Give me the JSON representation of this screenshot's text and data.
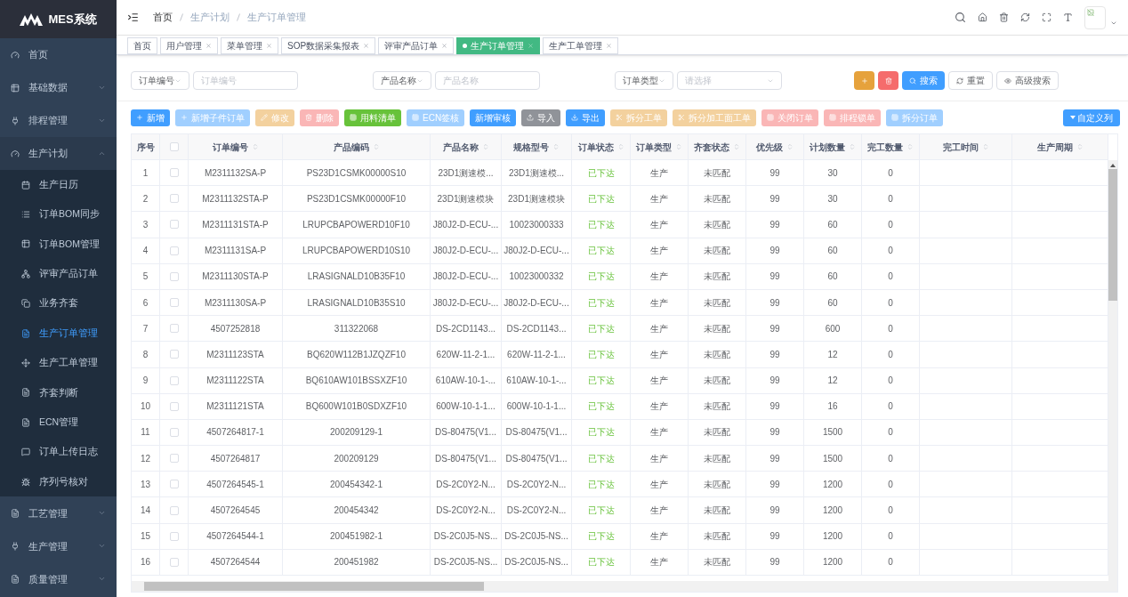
{
  "brand": {
    "title": "MES系统"
  },
  "sidebar": {
    "items": [
      {
        "label": "首页"
      },
      {
        "label": "基础数据",
        "expanded": false
      },
      {
        "label": "排程管理",
        "expanded": false
      },
      {
        "label": "生产计划",
        "expanded": true,
        "children": [
          {
            "label": "生产日历",
            "selected": false
          },
          {
            "label": "订单BOM同步",
            "selected": false
          },
          {
            "label": "订单BOM管理",
            "selected": false
          },
          {
            "label": "评审产品订单",
            "selected": false
          },
          {
            "label": "业务齐套",
            "selected": false
          },
          {
            "label": "生产订单管理",
            "selected": true
          },
          {
            "label": "生产工单管理",
            "selected": false
          },
          {
            "label": "齐套判断",
            "selected": false
          },
          {
            "label": "ECN管理",
            "selected": false
          },
          {
            "label": "订单上传日志",
            "selected": false
          },
          {
            "label": "序列号核对",
            "selected": false
          }
        ]
      },
      {
        "label": "工艺管理",
        "expanded": false
      },
      {
        "label": "生产管理",
        "expanded": false
      },
      {
        "label": "质量管理",
        "expanded": false
      }
    ]
  },
  "breadcrumb": [
    "首页",
    "生产计划",
    "生产订单管理"
  ],
  "tags": [
    {
      "label": "首页",
      "selected": false,
      "closable": false
    },
    {
      "label": "用户管理",
      "selected": false,
      "closable": true
    },
    {
      "label": "菜单管理",
      "selected": false,
      "closable": true
    },
    {
      "label": "SOP数据采集报表",
      "selected": false,
      "closable": true
    },
    {
      "label": "评审产品订单",
      "selected": false,
      "closable": true
    },
    {
      "label": "生产订单管理",
      "selected": true,
      "closable": true
    },
    {
      "label": "生产工单管理",
      "selected": false,
      "closable": true
    }
  ],
  "filters": [
    {
      "field": "订单编号",
      "placeholder": "订单编号",
      "kind": "input"
    },
    {
      "field": "产品名称",
      "placeholder": "产品名称",
      "kind": "input"
    },
    {
      "field": "订单类型",
      "placeholder": "请选择",
      "kind": "select"
    }
  ],
  "search_buttons": [
    {
      "kind": "add"
    },
    {
      "kind": "delete"
    },
    {
      "kind": "search",
      "label": "搜索"
    },
    {
      "kind": "reset",
      "label": "重置"
    },
    {
      "kind": "advanced",
      "label": "高级搜索"
    }
  ],
  "actions": [
    {
      "label": "新增",
      "kind": "primary",
      "disabled": false
    },
    {
      "label": "新增子件订单",
      "kind": "primary",
      "disabled": true
    },
    {
      "label": "修改",
      "kind": "warning",
      "disabled": true
    },
    {
      "label": "删除",
      "kind": "danger",
      "disabled": true
    },
    {
      "label": "用料清单",
      "kind": "success",
      "disabled": false
    },
    {
      "label": "ECN签核",
      "kind": "primary",
      "disabled": true
    },
    {
      "label": "新增审核",
      "kind": "primary",
      "disabled": false
    },
    {
      "label": "导入",
      "kind": "info",
      "disabled": false
    },
    {
      "label": "导出",
      "kind": "primary",
      "disabled": false
    },
    {
      "label": "拆分工单",
      "kind": "warning",
      "disabled": true
    },
    {
      "label": "拆分加工面工单",
      "kind": "warning",
      "disabled": true
    },
    {
      "label": "关闭订单",
      "kind": "danger",
      "disabled": true
    },
    {
      "label": "排程锁单",
      "kind": "danger",
      "disabled": true
    },
    {
      "label": "拆分订单",
      "kind": "primary",
      "disabled": true
    }
  ],
  "custom_columns": {
    "label": "自定义列"
  },
  "table": {
    "header_checked": false,
    "columns": [
      {
        "label": "序号",
        "kind": "index",
        "sortable": false
      },
      {
        "kind": "check"
      },
      {
        "label": "订单编号",
        "kind": "text",
        "sortable": true
      },
      {
        "label": "产品编码",
        "kind": "text",
        "sortable": true
      },
      {
        "label": "产品名称",
        "kind": "text",
        "sortable": true
      },
      {
        "label": "规格型号",
        "kind": "text",
        "sortable": true
      },
      {
        "label": "订单状态",
        "kind": "status",
        "sortable": true
      },
      {
        "label": "订单类型",
        "kind": "text",
        "sortable": true
      },
      {
        "label": "齐套状态",
        "kind": "text",
        "sortable": true
      },
      {
        "label": "优先级",
        "kind": "text",
        "sortable": true
      },
      {
        "label": "计划数量",
        "kind": "text",
        "sortable": true
      },
      {
        "label": "完工数量",
        "kind": "text",
        "sortable": true
      },
      {
        "label": "完工时间",
        "kind": "text",
        "sortable": true
      },
      {
        "label": "生产周期",
        "kind": "text",
        "sortable": true
      }
    ],
    "rows": [
      {
        "checked": false,
        "cells": [
          "1",
          null,
          "M2311132SA-P",
          "PS23D1CSMK00000S10",
          "23D1测速模...",
          "23D1测速模...",
          "已下达",
          "生产",
          "未匹配",
          "99",
          "30",
          "0",
          null,
          null
        ]
      },
      {
        "checked": false,
        "cells": [
          "2",
          null,
          "M2311132STA-P",
          "PS23D1CSMK00000F10",
          "23D1测速模块",
          "23D1测速模块",
          "已下达",
          "生产",
          "未匹配",
          "99",
          "30",
          "0",
          null,
          null
        ]
      },
      {
        "checked": false,
        "cells": [
          "3",
          null,
          "M2311131STA-P",
          "LRUPCBAPOWERD10F10",
          "J80J2-D-ECU-...",
          "10023000333",
          "已下达",
          "生产",
          "未匹配",
          "99",
          "60",
          "0",
          null,
          null
        ]
      },
      {
        "checked": false,
        "cells": [
          "4",
          null,
          "M2311131SA-P",
          "LRUPCBAPOWERD10S10",
          "J80J2-D-ECU-...",
          "J80J2-D-ECU-...",
          "已下达",
          "生产",
          "未匹配",
          "99",
          "60",
          "0",
          null,
          null
        ]
      },
      {
        "checked": false,
        "cells": [
          "5",
          null,
          "M2311130STA-P",
          "LRASIGNALD10B35F10",
          "J80J2-D-ECU-...",
          "10023000332",
          "已下达",
          "生产",
          "未匹配",
          "99",
          "60",
          "0",
          null,
          null
        ]
      },
      {
        "checked": false,
        "cells": [
          "6",
          null,
          "M2311130SA-P",
          "LRASIGNALD10B35S10",
          "J80J2-D-ECU-...",
          "J80J2-D-ECU-...",
          "已下达",
          "生产",
          "未匹配",
          "99",
          "60",
          "0",
          null,
          null
        ]
      },
      {
        "checked": false,
        "cells": [
          "7",
          null,
          "4507252818",
          "311322068",
          "DS-2CD1143...",
          "DS-2CD1143...",
          "已下达",
          "生产",
          "未匹配",
          "99",
          "600",
          "0",
          null,
          null
        ]
      },
      {
        "checked": false,
        "cells": [
          "8",
          null,
          "M2311123STA",
          "BQ620W112B1JZQZF10",
          "620W-11-2-1...",
          "620W-11-2-1...",
          "已下达",
          "生产",
          "未匹配",
          "99",
          "12",
          "0",
          null,
          null
        ]
      },
      {
        "checked": false,
        "cells": [
          "9",
          null,
          "M2311122STA",
          "BQ610AW101BSSXZF10",
          "610AW-10-1-...",
          "610AW-10-1-...",
          "已下达",
          "生产",
          "未匹配",
          "99",
          "12",
          "0",
          null,
          null
        ]
      },
      {
        "checked": false,
        "cells": [
          "10",
          null,
          "M2311121STA",
          "BQ600W101B0SDXZF10",
          "600W-10-1-1...",
          "600W-10-1-1...",
          "已下达",
          "生产",
          "未匹配",
          "99",
          "16",
          "0",
          null,
          null
        ]
      },
      {
        "checked": false,
        "cells": [
          "11",
          null,
          "4507264817-1",
          "200209129-1",
          "DS-80475(V1...",
          "DS-80475(V1...",
          "已下达",
          "生产",
          "未匹配",
          "99",
          "1500",
          "0",
          null,
          null
        ]
      },
      {
        "checked": false,
        "cells": [
          "12",
          null,
          "4507264817",
          "200209129",
          "DS-80475(V1...",
          "DS-80475(V1...",
          "已下达",
          "生产",
          "未匹配",
          "99",
          "1500",
          "0",
          null,
          null
        ]
      },
      {
        "checked": false,
        "cells": [
          "13",
          null,
          "4507264545-1",
          "200454342-1",
          "DS-2C0Y2-N...",
          "DS-2C0Y2-N...",
          "已下达",
          "生产",
          "未匹配",
          "99",
          "1200",
          "0",
          null,
          null
        ]
      },
      {
        "checked": false,
        "cells": [
          "14",
          null,
          "4507264545",
          "200454342",
          "DS-2C0Y2-N...",
          "DS-2C0Y2-N...",
          "已下达",
          "生产",
          "未匹配",
          "99",
          "1200",
          "0",
          null,
          null
        ]
      },
      {
        "checked": false,
        "cells": [
          "15",
          null,
          "4507264544-1",
          "200451982-1",
          "DS-2C0J5-NS...",
          "DS-2C0J5-NS...",
          "已下达",
          "生产",
          "未匹配",
          "99",
          "1200",
          "0",
          null,
          null
        ]
      },
      {
        "checked": false,
        "cells": [
          "16",
          null,
          "4507264544",
          "200451982",
          "DS-2C0J5-NS...",
          "DS-2C0J5-NS...",
          "已下达",
          "生产",
          "未匹配",
          "99",
          "1200",
          "0",
          null,
          null
        ]
      }
    ]
  }
}
